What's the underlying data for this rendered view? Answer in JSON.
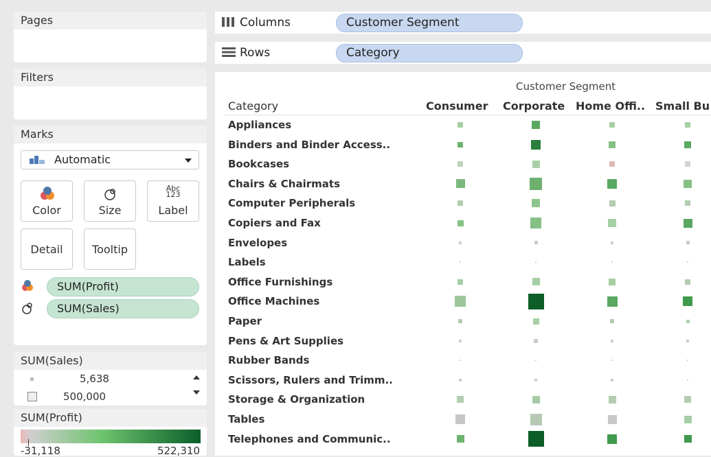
{
  "cards": {
    "pages_title": "Pages",
    "filters_title": "Filters",
    "marks_title": "Marks"
  },
  "marks": {
    "mark_type": "Automatic",
    "buttons": {
      "color": "Color",
      "size": "Size",
      "label": "Label",
      "label_glyph_top": "Abc",
      "label_glyph_bottom": "123",
      "detail": "Detail",
      "tooltip": "Tooltip"
    },
    "pills": [
      "SUM(Profit)",
      "SUM(Sales)"
    ]
  },
  "shelves": {
    "columns_label": "Columns",
    "columns_pill": "Customer Segment",
    "rows_label": "Rows",
    "rows_pill": "Category"
  },
  "view": {
    "segment_header": "Customer Segment",
    "category_header": "Category",
    "columns": [
      "Consumer",
      "Corporate",
      "Home Offi..",
      "Small Bu"
    ],
    "rows": [
      "Appliances",
      "Binders and Binder Access..",
      "Bookcases",
      "Chairs & Chairmats",
      "Computer Peripherals",
      "Copiers and Fax",
      "Envelopes",
      "Labels",
      "Office Furnishings",
      "Office Machines",
      "Paper",
      "Pens & Art Supplies",
      "Rubber Bands",
      "Scissors, Rulers and Trimm..",
      "Storage & Organization",
      "Tables",
      "Telephones and Communic.."
    ],
    "cells": [
      [
        {
          "s": 0.28,
          "c": "#a6cfa4"
        },
        {
          "s": 0.4,
          "c": "#5aa863"
        },
        {
          "s": 0.28,
          "c": "#a6cfa4"
        },
        {
          "s": 0.28,
          "c": "#a6cfa4"
        }
      ],
      [
        {
          "s": 0.28,
          "c": "#6eb470"
        },
        {
          "s": 0.48,
          "c": "#2a7f3a"
        },
        {
          "s": 0.34,
          "c": "#86c084"
        },
        {
          "s": 0.34,
          "c": "#5aa863"
        }
      ],
      [
        {
          "s": 0.26,
          "c": "#bfd3bf"
        },
        {
          "s": 0.38,
          "c": "#a9cfa4"
        },
        {
          "s": 0.26,
          "c": "#e2b7b7"
        },
        {
          "s": 0.26,
          "c": "#cfd5cf"
        }
      ],
      [
        {
          "s": 0.42,
          "c": "#7db87c"
        },
        {
          "s": 0.6,
          "c": "#6fb06e"
        },
        {
          "s": 0.48,
          "c": "#5aa863"
        },
        {
          "s": 0.4,
          "c": "#86c084"
        }
      ],
      [
        {
          "s": 0.28,
          "c": "#b3cdb0"
        },
        {
          "s": 0.4,
          "c": "#8fc38d"
        },
        {
          "s": 0.3,
          "c": "#b3cdb0"
        },
        {
          "s": 0.26,
          "c": "#b3cdb0"
        }
      ],
      [
        {
          "s": 0.3,
          "c": "#86c084"
        },
        {
          "s": 0.52,
          "c": "#86c084"
        },
        {
          "s": 0.4,
          "c": "#a6cfa4"
        },
        {
          "s": 0.42,
          "c": "#5aa863"
        }
      ],
      [
        {
          "s": 0.12,
          "c": "#c9cec9"
        },
        {
          "s": 0.18,
          "c": "#bfcfbf"
        },
        {
          "s": 0.12,
          "c": "#c9cec9"
        },
        {
          "s": 0.16,
          "c": "#bfcfbf"
        }
      ],
      [
        {
          "s": 0.04,
          "c": "#d3d3d3"
        },
        {
          "s": 0.04,
          "c": "#d3d3d3"
        },
        {
          "s": 0.04,
          "c": "#d3d3d3"
        },
        {
          "s": 0.04,
          "c": "#d3d3d3"
        }
      ],
      [
        {
          "s": 0.28,
          "c": "#a6cfa4"
        },
        {
          "s": 0.36,
          "c": "#a6cfa4"
        },
        {
          "s": 0.32,
          "c": "#a6cfa4"
        },
        {
          "s": 0.26,
          "c": "#b3cdb0"
        }
      ],
      [
        {
          "s": 0.54,
          "c": "#9cc69a"
        },
        {
          "s": 0.76,
          "c": "#0d5e28"
        },
        {
          "s": 0.5,
          "c": "#5aa863"
        },
        {
          "s": 0.48,
          "c": "#3f9a4d"
        }
      ],
      [
        {
          "s": 0.2,
          "c": "#b3cdb0"
        },
        {
          "s": 0.3,
          "c": "#a6cfa4"
        },
        {
          "s": 0.2,
          "c": "#b3cdb0"
        },
        {
          "s": 0.18,
          "c": "#b3cdb0"
        }
      ],
      [
        {
          "s": 0.14,
          "c": "#c9cec9"
        },
        {
          "s": 0.2,
          "c": "#c9cec9"
        },
        {
          "s": 0.14,
          "c": "#c9cec9"
        },
        {
          "s": 0.12,
          "c": "#c9cec9"
        }
      ],
      [
        {
          "s": 0.04,
          "c": "#d3d3d3"
        },
        {
          "s": 0.04,
          "c": "#d3d3d3"
        },
        {
          "s": 0.04,
          "c": "#d3d3d3"
        },
        {
          "s": 0.04,
          "c": "#d3d3d3"
        }
      ],
      [
        {
          "s": 0.12,
          "c": "#c9cec9"
        },
        {
          "s": 0.12,
          "c": "#c9cec9"
        },
        {
          "s": 0.12,
          "c": "#c9cec9"
        },
        {
          "s": 0.04,
          "c": "#d3d3d3"
        }
      ],
      [
        {
          "s": 0.32,
          "c": "#b3cdb0"
        },
        {
          "s": 0.38,
          "c": "#a9cba6"
        },
        {
          "s": 0.38,
          "c": "#b3cdb0"
        },
        {
          "s": 0.32,
          "c": "#b3cdb0"
        }
      ],
      [
        {
          "s": 0.46,
          "c": "#c7c7c7"
        },
        {
          "s": 0.58,
          "c": "#b7c9b5"
        },
        {
          "s": 0.44,
          "c": "#c7c7c7"
        },
        {
          "s": 0.38,
          "c": "#a6cfa4"
        }
      ],
      [
        {
          "s": 0.38,
          "c": "#6eb470"
        },
        {
          "s": 0.76,
          "c": "#0d5e28"
        },
        {
          "s": 0.48,
          "c": "#3f9a4d"
        },
        {
          "s": 0.38,
          "c": "#3f9a4d"
        }
      ]
    ]
  },
  "legends": {
    "sales_title": "SUM(Sales)",
    "sales_items": [
      "5,638",
      "500,000"
    ],
    "profit_title": "SUM(Profit)",
    "profit_min": "-31,118",
    "profit_max": "522,310"
  }
}
